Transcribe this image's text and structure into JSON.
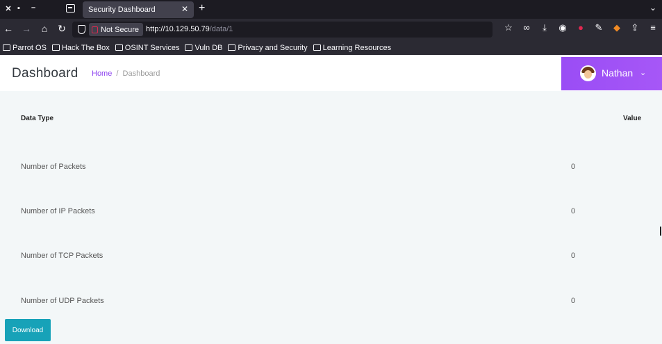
{
  "browser": {
    "tab_title": "Security Dashboard",
    "tab_close": "✕",
    "new_tab": "+",
    "tabbar_menu": "⌄",
    "window_controls": [
      "✕",
      "▪",
      "–"
    ],
    "security_label": "Not Secure",
    "url_host": "http://10.129.50.79",
    "url_path": "/data/1",
    "nav": {
      "back": "←",
      "forward": "→",
      "home": "⌂",
      "reload": "↻"
    },
    "toolbar_icons": [
      "star-icon",
      "mask-icon",
      "download-icon",
      "account-icon",
      "ublock-icon",
      "wrench-icon",
      "fox-icon",
      "extensions-icon",
      "menu-icon"
    ],
    "toolbar_glyphs": [
      "☆",
      "∞",
      "⤓",
      "◉",
      "●",
      "✎",
      "◆",
      "⇪",
      "≡"
    ]
  },
  "bookmarks": [
    "Parrot OS",
    "Hack The Box",
    "OSINT Services",
    "Vuln DB",
    "Privacy and Security",
    "Learning Resources"
  ],
  "header": {
    "title": "Dashboard",
    "breadcrumb_home": "Home",
    "breadcrumb_sep": "/",
    "breadcrumb_current": "Dashboard",
    "user_name": "Nathan",
    "user_chevron": "⌄",
    "accent_color": "#9a4df5"
  },
  "table": {
    "headers": [
      "Data Type",
      "Value"
    ],
    "rows": [
      {
        "label": "Number of Packets",
        "value": "0"
      },
      {
        "label": "Number of IP Packets",
        "value": "0"
      },
      {
        "label": "Number of TCP Packets",
        "value": "0"
      },
      {
        "label": "Number of UDP Packets",
        "value": "0"
      }
    ]
  },
  "download_label": "Download",
  "download_color": "#17a2b8"
}
